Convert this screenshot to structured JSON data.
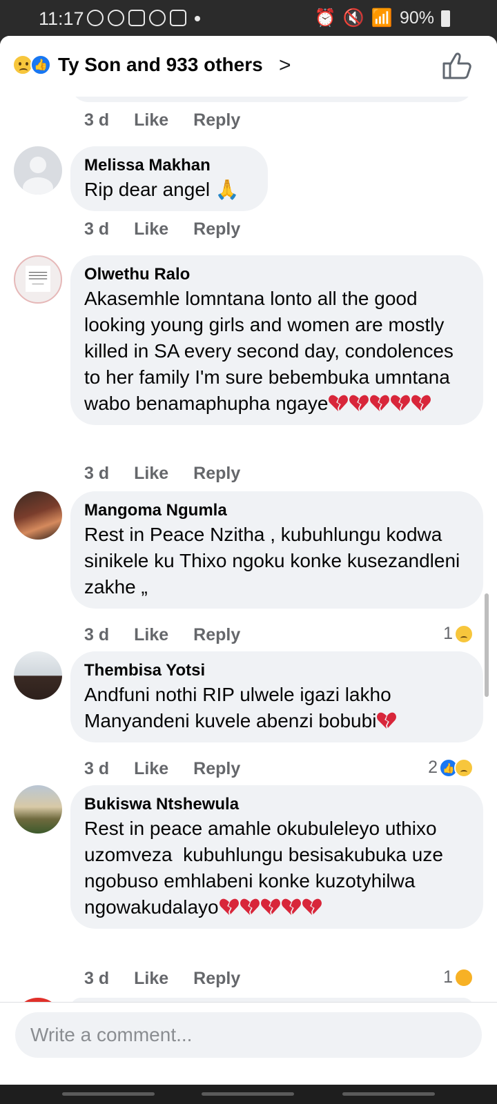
{
  "status_bar": {
    "time": "11:17",
    "battery": "90%"
  },
  "header": {
    "title": "Ty Son and 933 others"
  },
  "comments": [
    {
      "name": "Melissa Makhan",
      "text": "Rip dear angel 🙏",
      "age": "3 d",
      "like": "Like",
      "reply": "Reply",
      "reaction_count": ""
    },
    {
      "name": "Olwethu Ralo",
      "text": "Akasemhle lomntana lonto all the good looking young girls and women are mostly killed in SA every second day, condolences to her family I'm sure bebembuka umntana wabo benamaphupha ngaye",
      "hearts": 5,
      "age": "3 d",
      "like": "Like",
      "reply": "Reply",
      "reaction_count": ""
    },
    {
      "name": "Mangoma Ngumla",
      "text": "Rest in Peace Nzitha , kubuhlungu kodwa sinikele ku Thixo ngoku konke kusezandleni zakhe „",
      "age": "3 d",
      "like": "Like",
      "reply": "Reply",
      "reaction_count": "1"
    },
    {
      "name": "Thembisa Yotsi",
      "text": "Andfuni nothi RIP ulwele igazi lakho Manyandeni kuvele abenzi bobubi",
      "hearts": 1,
      "age": "3 d",
      "like": "Like",
      "reply": "Reply",
      "reaction_count": "2"
    },
    {
      "name": "Bukiswa Ntshewula",
      "text": "Rest in peace amahle okubuleleyo uthixo uzomveza  kubuhlungu besisakubuka uze ngobuso emhlabeni konke kuzotyhilwa ngowakudalayo",
      "hearts": 5,
      "age": "3 d",
      "like": "Like",
      "reply": "Reply",
      "reaction_count": "1"
    }
  ],
  "top_partial": {
    "age": "3 d",
    "like": "Like",
    "reply": "Reply"
  },
  "composer": {
    "placeholder": "Write a comment..."
  },
  "colors": {
    "accent": "#1877f2",
    "bubble": "#f0f2f5",
    "meta": "#65676b",
    "heart": "#d8263a"
  },
  "icons": [
    "sad-reaction-icon",
    "like-reaction-icon",
    "chevron-right-icon",
    "thumbs-up-icon",
    "broken-heart-icon",
    "care-reaction-icon"
  ]
}
